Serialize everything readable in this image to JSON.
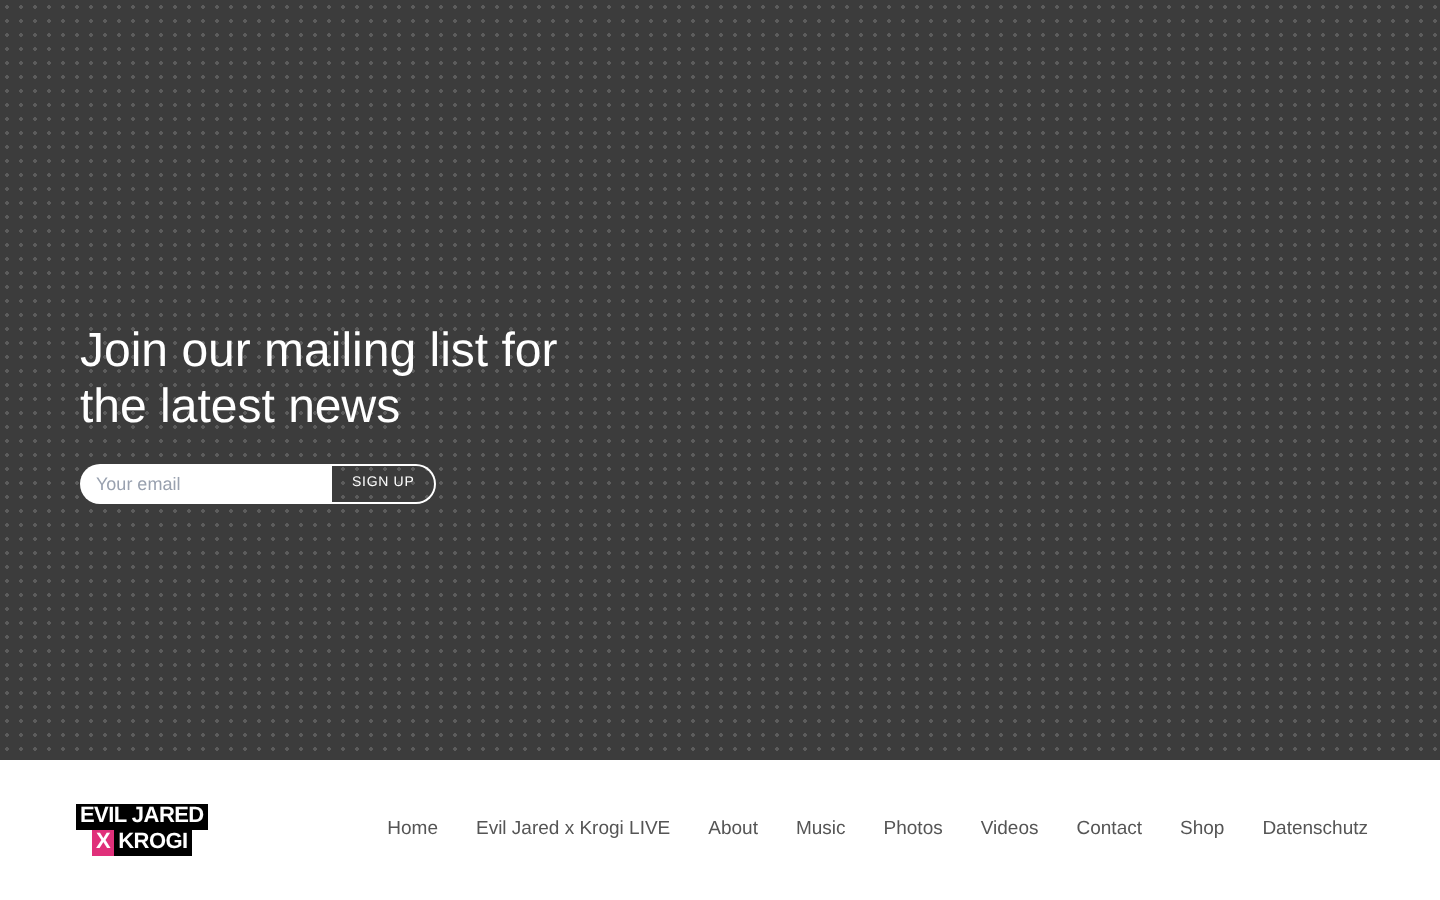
{
  "hero": {
    "heading": "Join our mailing list for the latest news",
    "email": {
      "placeholder": "Your email"
    },
    "button": "SIGN UP"
  },
  "footer": {
    "logo": {
      "line_1": "EVIL JARED",
      "x": "X",
      "line_2": "KROGI"
    },
    "nav": [
      "Home",
      "Evil Jared x Krogi LIVE",
      "About",
      "Music",
      "Photos",
      "Videos",
      "Contact",
      "Shop",
      "Datenschutz"
    ]
  }
}
